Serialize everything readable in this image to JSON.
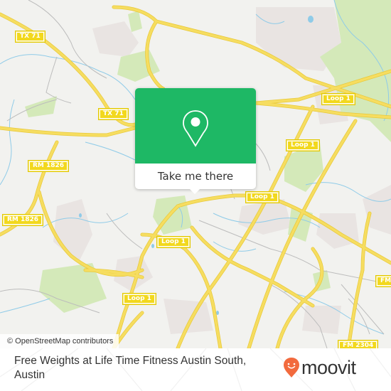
{
  "map": {
    "colors": {
      "land": "#f2f2ef",
      "road_major": "#f6dd60",
      "road_casing": "#e8c93a",
      "road_minor": "#bcbcbc",
      "water": "#8fcbe8",
      "park": "#d4e9b9",
      "urban": "#e9e4e2",
      "shield_bg": "#f2d81d"
    },
    "road_labels": [
      {
        "id": "tx71-north",
        "text": "TX 71"
      },
      {
        "id": "tx71-south",
        "text": "TX 71"
      },
      {
        "id": "rm1826-north",
        "text": "RM 1826"
      },
      {
        "id": "rm1826-south",
        "text": "RM 1826"
      },
      {
        "id": "loop1-ne",
        "text": "Loop 1"
      },
      {
        "id": "loop1-mid-upper",
        "text": "Loop 1"
      },
      {
        "id": "loop1-mid",
        "text": "Loop 1"
      },
      {
        "id": "loop1-sw-upper",
        "text": "Loop 1"
      },
      {
        "id": "loop1-sw-lower",
        "text": "Loop 1"
      },
      {
        "id": "fm-east",
        "text": "FM"
      },
      {
        "id": "fm2304",
        "text": "FM 2304"
      }
    ],
    "attribution": "© OpenStreetMap contributors"
  },
  "popup": {
    "icon": "map-pin-icon",
    "accent_color": "#1eb865",
    "cta_label": "Take me there"
  },
  "footer": {
    "place_name": "Free Weights at Life Time Fitness Austin South, Austin",
    "brand": {
      "name": "moovit",
      "icon": "moovit-smile-pin-icon",
      "icon_color": "#f26a3d"
    }
  }
}
